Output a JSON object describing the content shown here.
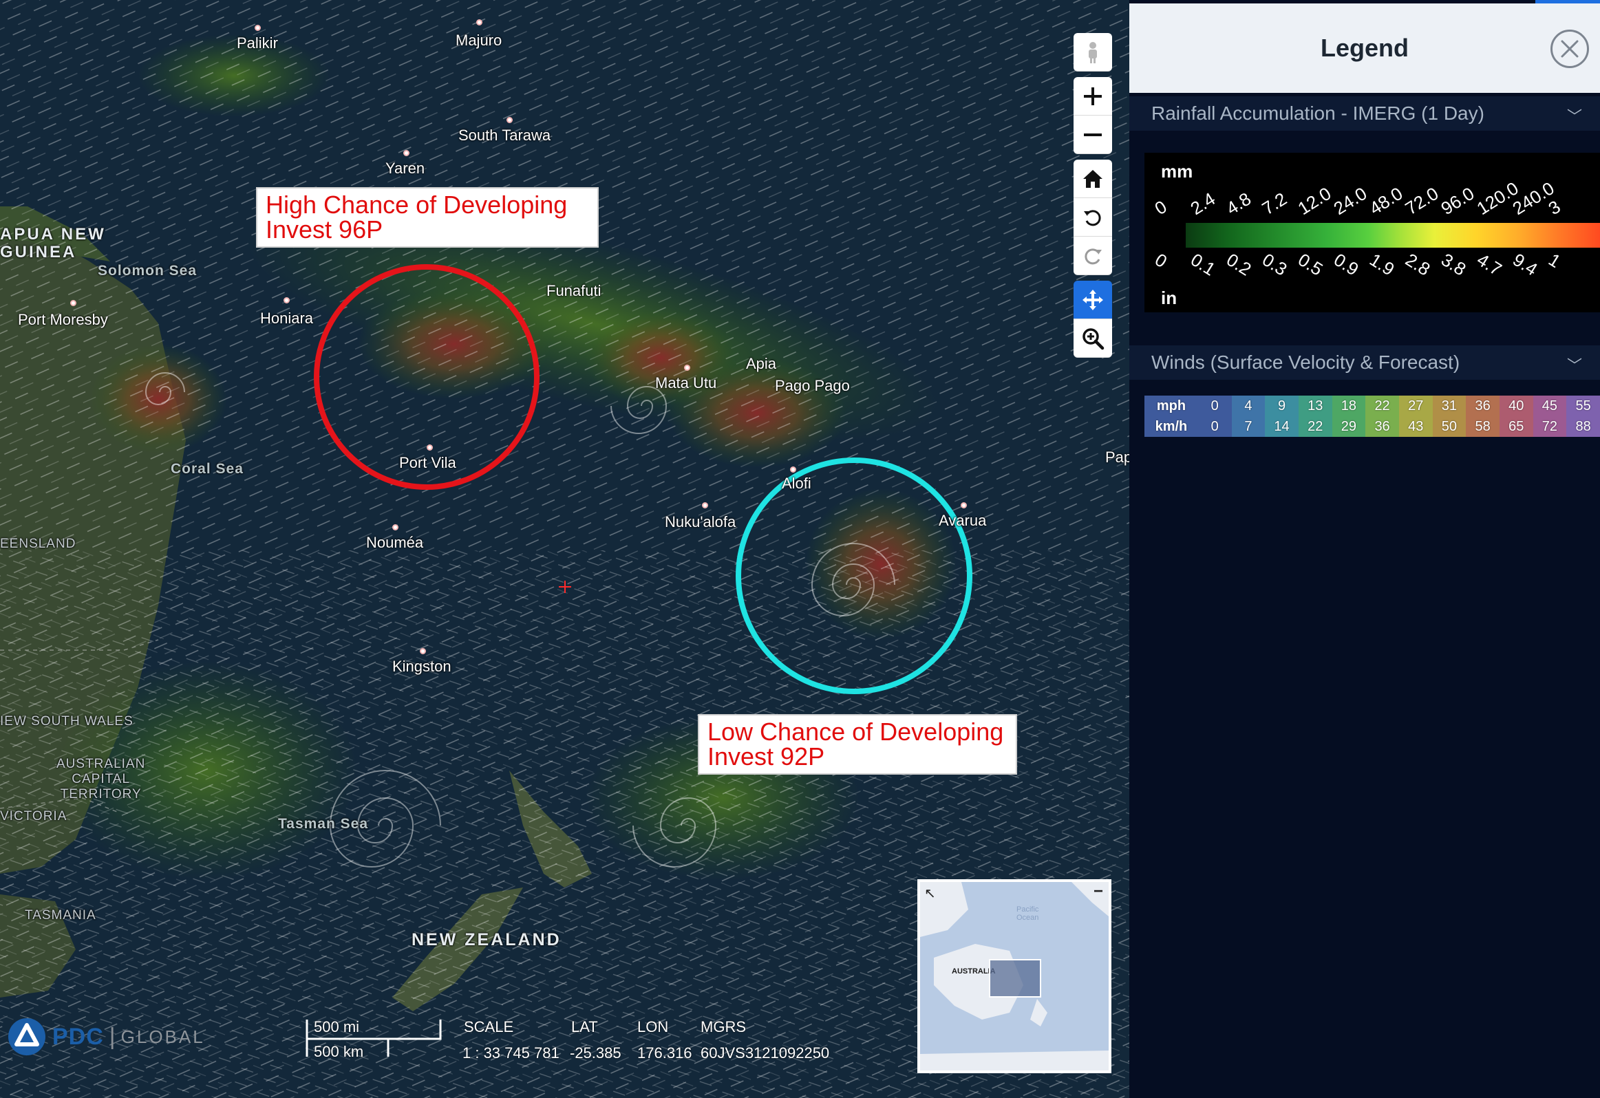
{
  "map": {
    "places": {
      "palikir": "Palikir",
      "majuro": "Majuro",
      "south_tarawa": "South Tarawa",
      "yaren": "Yaren",
      "papua_new_guinea_1": "APUA NEW",
      "papua_new_guinea_2": "GUINEA",
      "solomon_sea": "Solomon Sea",
      "port_moresby": "Port Moresby",
      "honiara": "Honiara",
      "funafuti": "Funafuti",
      "apia": "Apia",
      "mata_utu": "Mata Utu",
      "pago_pago": "Pago Pago",
      "port_vila": "Port Vila",
      "coral_sea": "Coral Sea",
      "queensland": "EENSLAND",
      "noumea": "Nouméa",
      "alofi": "Alofi",
      "nukualofa": "Nuku'alofa",
      "avarua": "Avarua",
      "pap": "Pap",
      "kingston": "Kingston",
      "new_south_wales": "IEW SOUTH WALES",
      "act_1": "AUSTRALIAN",
      "act_2": "CAPITAL",
      "act_3": "TERRITORY",
      "victoria": "VICTORIA",
      "tasman_sea": "Tasman Sea",
      "tasmania": "TASMANIA",
      "new_zealand": "NEW ZEALAND"
    },
    "callouts": {
      "invest_96p_line1": "High Chance of Developing",
      "invest_96p_line2": "Invest 96P",
      "invest_92p_line1": "Low Chance of Developing",
      "invest_92p_line2": "Invest 92P"
    },
    "colors": {
      "high_chance_circle": "#e5141a",
      "low_chance_circle": "#1fe3e3",
      "callout_text": "#e10d0d"
    },
    "toolbar": {
      "icons": [
        "street-view-icon",
        "zoom-in-icon",
        "zoom-out-icon",
        "home-icon",
        "rotate-left-icon",
        "rotate-right-icon",
        "pan-icon",
        "zoom-box-icon"
      ]
    },
    "brand": {
      "pdc": "PDC",
      "separator": "|",
      "global": "GLOBAL"
    },
    "scalebar": {
      "miles": "500 mi",
      "km": "500 km"
    },
    "status": {
      "scale_label": "SCALE",
      "scale_value": "1 : 33 745 781",
      "lat_label": "LAT",
      "lat_value": "-25.385",
      "lon_label": "LON",
      "lon_value": "176.316",
      "mgrs_label": "MGRS",
      "mgrs_value": "60JVS3121092250"
    },
    "minimap": {
      "ocean_line1": "Pacific",
      "ocean_line2": "Ocean",
      "australia": "AUSTRALIA"
    }
  },
  "legend": {
    "title": "Legend",
    "rainfall": {
      "title": "Rainfall Accumulation - IMERG (1 Day)",
      "unit_mm": "mm",
      "unit_in": "in",
      "mm_ticks": [
        "0",
        "2.4",
        "4.8",
        "7.2",
        "12.0",
        "24.0",
        "48.0",
        "72.0",
        "96.0",
        "120.0",
        "240.0",
        "3"
      ],
      "in_ticks": [
        "0",
        "0.1",
        "0.2",
        "0.3",
        "0.5",
        "0.9",
        "1.9",
        "2.8",
        "3.8",
        "4.7",
        "9.4",
        "1"
      ]
    },
    "winds": {
      "title": "Winds (Surface Velocity & Forecast)",
      "mph_label": "mph",
      "kmh_label": "km/h",
      "mph": [
        "0",
        "4",
        "9",
        "13",
        "18",
        "22",
        "27",
        "31",
        "36",
        "40",
        "45",
        "55"
      ],
      "kmh": [
        "0",
        "7",
        "14",
        "22",
        "29",
        "36",
        "43",
        "50",
        "58",
        "65",
        "72",
        "88"
      ],
      "colors": [
        "#3e5a9c",
        "#3f74a8",
        "#3c8ea0",
        "#3f9d83",
        "#4ea764",
        "#7aaf4e",
        "#a8a846",
        "#b08f47",
        "#b37050",
        "#ad5c6f",
        "#9c5a92",
        "#7e62ae"
      ]
    }
  }
}
